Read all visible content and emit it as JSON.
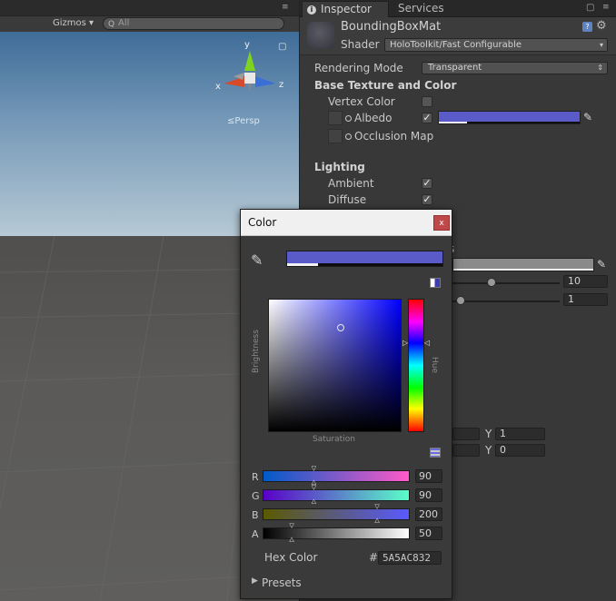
{
  "scene": {
    "gizmos_label": "Gizmos",
    "gizmos_arrow": "▾",
    "search_placeholder": "All",
    "search_icon": "Q",
    "axis_x": "x",
    "axis_y": "y",
    "axis_z": "z",
    "persp_label": "Persp",
    "persp_glyph": "≤",
    "menu_icon": "≡",
    "lock_icon": "🔒",
    "sky_color_top": "#3f6c98",
    "ground_color": "#5b5a58"
  },
  "inspector": {
    "tabs": [
      {
        "label": "Inspector",
        "icon": "info-icon",
        "icon_glyph": "i"
      },
      {
        "label": "Services"
      }
    ],
    "lock_icon": "🔒",
    "menu_icon": "≡",
    "material": {
      "name": "BoundingBoxMat",
      "shader_label": "Shader",
      "shader_value": "HoloToolkit/Fast Configurable",
      "help_glyph": "?",
      "gear_glyph": "⚙",
      "dd_glyph": "▾"
    },
    "rendering_mode": {
      "label": "Rendering Mode",
      "value": "Transparent",
      "dd_glyph": "⇕"
    },
    "base_section": "Base Texture and Color",
    "vertex_color": {
      "label": "Vertex Color",
      "checked": false
    },
    "albedo": {
      "label": "Albedo",
      "checked": true,
      "check_glyph": "✓",
      "color": "#5a5ac8",
      "alpha": 0.2
    },
    "occlusion": {
      "label": "Occlusion Map"
    },
    "lighting_section": "Lighting",
    "ambient": {
      "label": "Ambient",
      "checked": true,
      "check_glyph": "✓"
    },
    "diffuse": {
      "label": "Diffuse",
      "checked": true,
      "check_glyph": "✓"
    },
    "hidden_fragment": "s",
    "numfields": [
      "10",
      "1"
    ],
    "tiling": [
      {
        "axis": "Y",
        "value": "1"
      },
      {
        "axis": "Y",
        "value": "0"
      }
    ],
    "eyedropper_glyph": "✎"
  },
  "picker": {
    "title": "Color",
    "close_glyph": "x",
    "eyedropper_glyph": "✎",
    "preview_color": "#5a5ac8",
    "preview_alpha": 0.2,
    "brightness_label": "Brightness",
    "saturation_label": "Saturation",
    "hue_label": "Hue",
    "hue_marker_left": "▷",
    "hue_marker_right": "◁",
    "thumb_top": "▽",
    "thumb_bottom": "△",
    "hue_deg": 240,
    "saturation": 0.55,
    "brightness": 0.78,
    "channels": [
      {
        "label": "R",
        "value": "90",
        "fraction": 0.35
      },
      {
        "label": "G",
        "value": "90",
        "fraction": 0.35
      },
      {
        "label": "B",
        "value": "200",
        "fraction": 0.78
      },
      {
        "label": "A",
        "value": "50",
        "fraction": 0.2
      }
    ],
    "hex_label": "Hex Color",
    "hex_hash": "#",
    "hex_value": "5A5AC832",
    "presets_label": "Presets",
    "presets_arrow": "▶"
  }
}
